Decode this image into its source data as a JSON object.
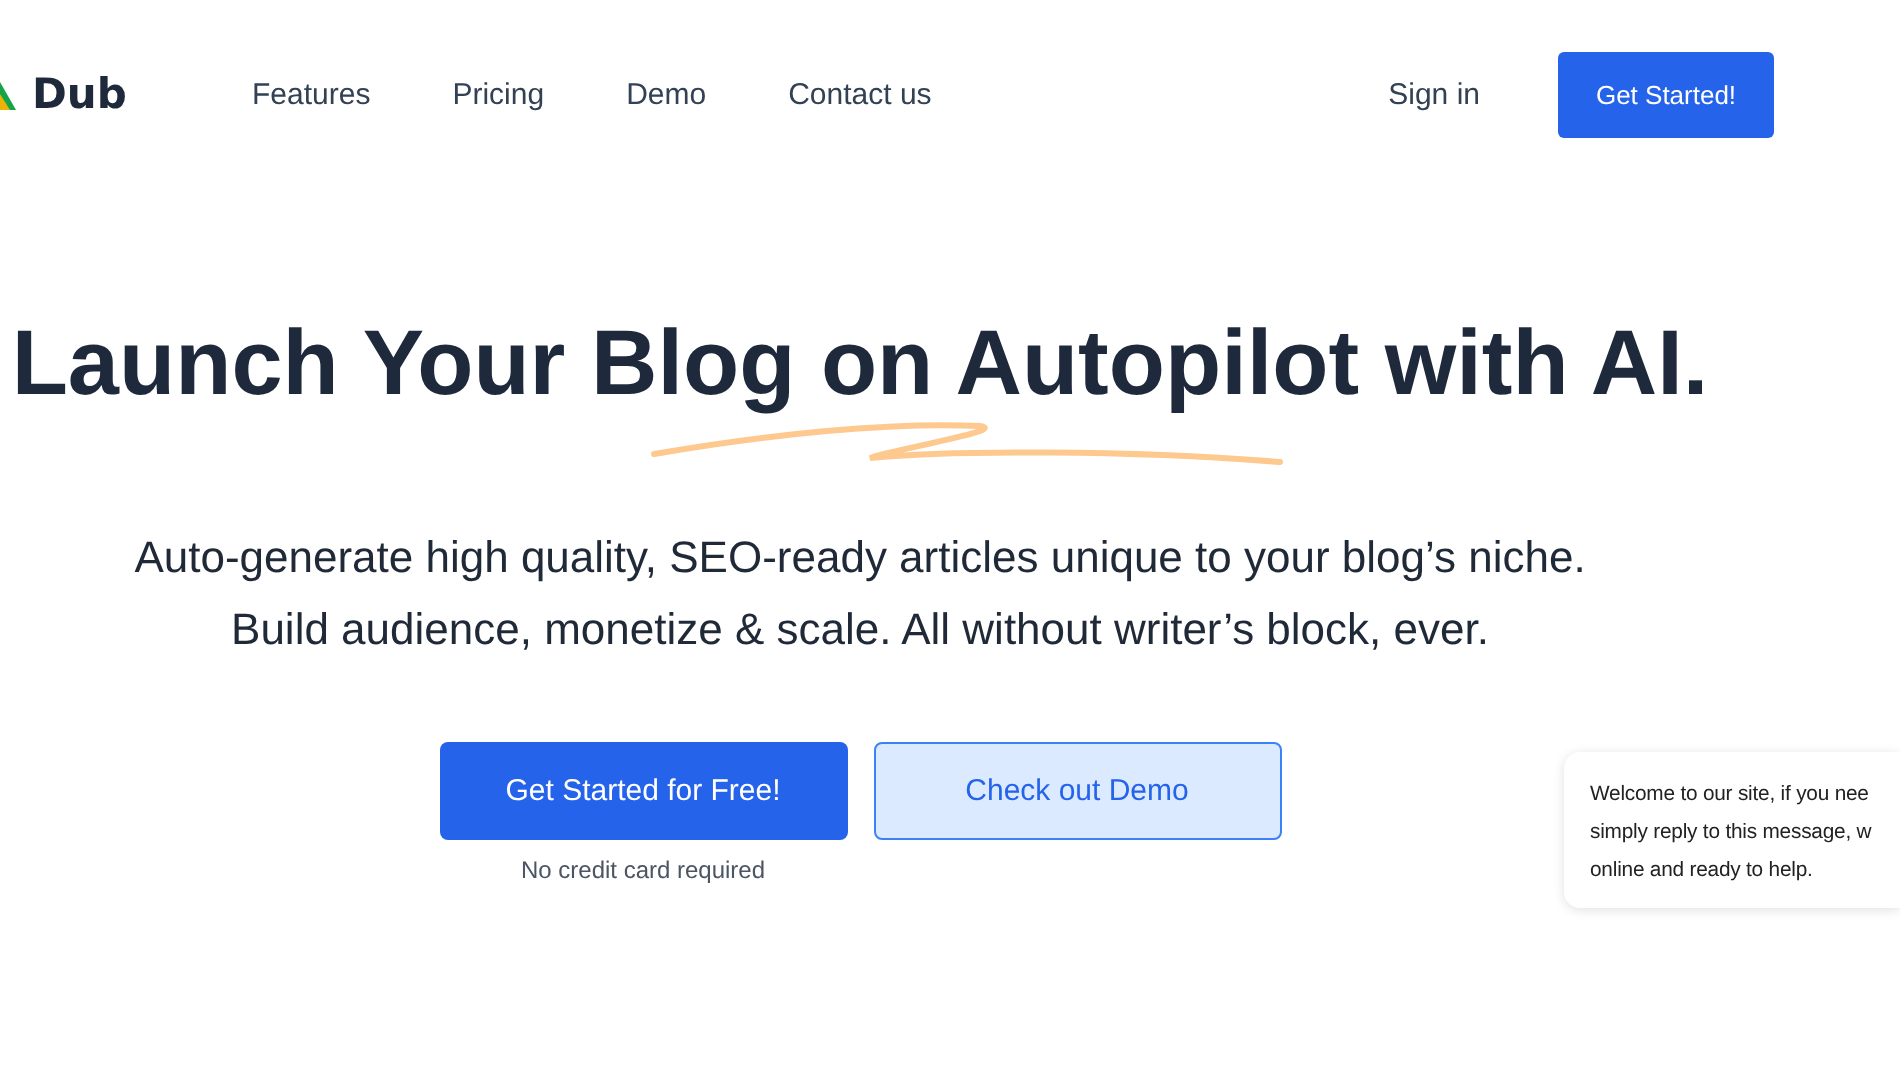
{
  "nav": {
    "logo": "Dub",
    "links": [
      "Features",
      "Pricing",
      "Demo",
      "Contact us"
    ],
    "sign_in": "Sign in",
    "cta": "Get Started!"
  },
  "hero": {
    "title": "Launch Your Blog on Autopilot with AI.",
    "subtitle_lines": [
      "Auto-generate high quality, SEO-ready articles unique to your blog’s niche.",
      "Build audience, monetize & scale. All without writer’s block, ever."
    ],
    "primary_button": "Get Started for Free!",
    "secondary_button": "Check out Demo",
    "note": "No credit card required"
  },
  "chat": {
    "lines": [
      "Welcome to our site, if you nee",
      "simply reply to this message, w",
      "online and ready to help."
    ]
  }
}
